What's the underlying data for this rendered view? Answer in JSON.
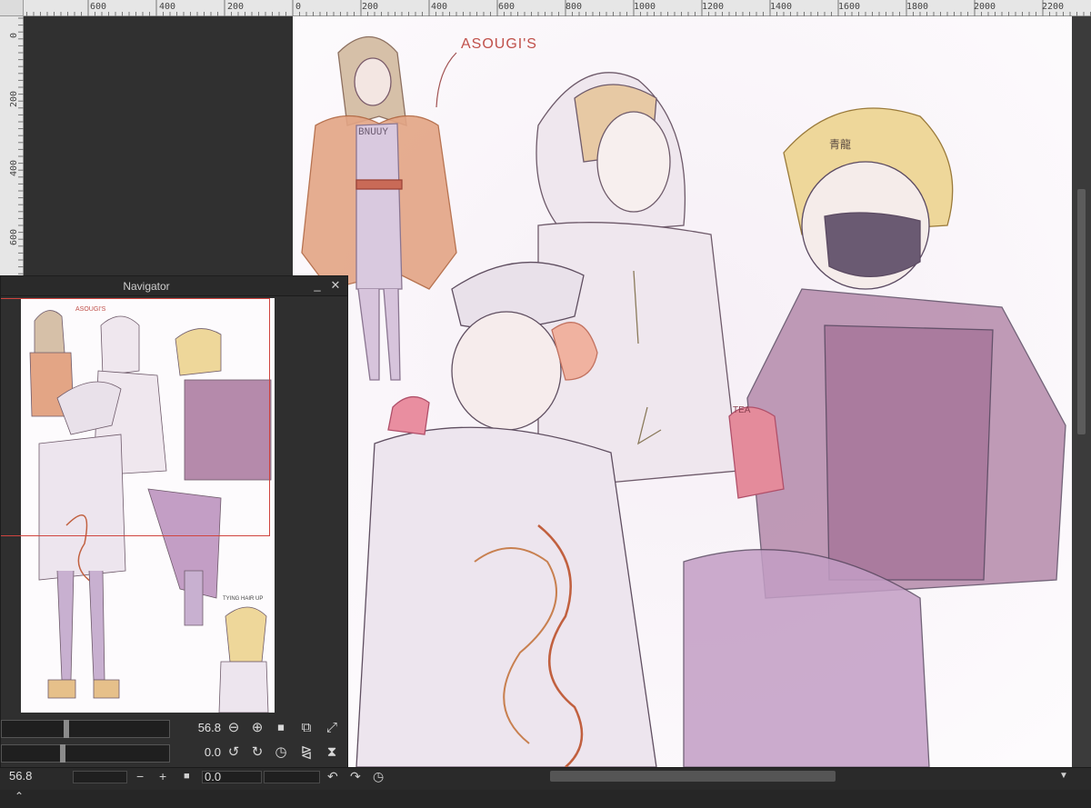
{
  "ruler": {
    "top_labels": [
      "600",
      "400",
      "200",
      "0",
      "200",
      "400",
      "600",
      "800",
      "1000",
      "1200",
      "1400",
      "1600",
      "1800",
      "2000",
      "2200"
    ],
    "left_labels": [
      "0",
      "200",
      "400",
      "600"
    ]
  },
  "canvas": {
    "sketch_label": "ASOUGI'S",
    "nav_sketch_label": "ASOUGI'S",
    "nav_note": "TYING HAIR UP",
    "shirt_text": "BNUUY",
    "beanie_text": "青龍",
    "cup_text": "TEA"
  },
  "navigator": {
    "title": "Navigator",
    "minimize_icon": "minimize-icon",
    "close_icon": "close-icon",
    "zoom_value": "56.8",
    "rotation_value": "0.0"
  },
  "statusbar": {
    "zoom_value": "56.8",
    "rotation_value": "0.0"
  },
  "colors": {
    "accent_red": "#d0443f",
    "panel_bg": "#2f2f2f",
    "canvas_bg": "#fdfbfd"
  }
}
